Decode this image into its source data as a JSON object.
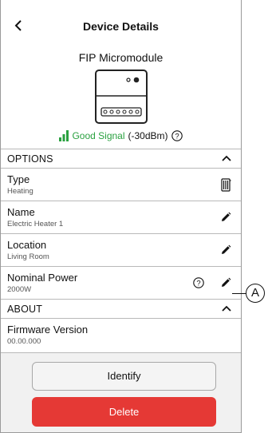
{
  "header": {
    "title": "Device Details",
    "device_name": "FIP Micromodule",
    "signal_quality": "Good Signal",
    "signal_strength": "(-30dBm)"
  },
  "options": {
    "label": "OPTIONS",
    "items": [
      {
        "title": "Type",
        "value": "Heating",
        "icon": "heater-icon"
      },
      {
        "title": "Name",
        "value": "Electric Heater 1",
        "icon": "edit-pencil-icon"
      },
      {
        "title": "Location",
        "value": "Living Room",
        "icon": "edit-pencil-icon"
      },
      {
        "title": "Nominal Power",
        "value": "2000W",
        "icon": "edit-pencil-icon"
      }
    ]
  },
  "about": {
    "label": "ABOUT",
    "firmware_title": "Firmware Version",
    "firmware_value": "00.00.000"
  },
  "callout": {
    "label": "A"
  },
  "actions": {
    "identify_label": "Identify",
    "delete_label": "Delete"
  },
  "colors": {
    "signal_green": "#2aa140",
    "delete_red": "#e53935"
  }
}
